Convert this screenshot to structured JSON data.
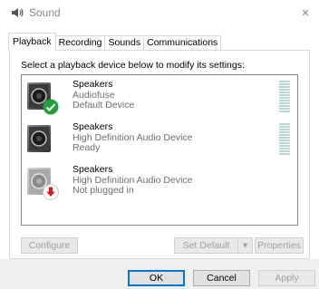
{
  "window": {
    "title": "Sound",
    "close_glyph": "×"
  },
  "tabs": [
    {
      "label": "Playback",
      "active": true
    },
    {
      "label": "Recording",
      "active": false
    },
    {
      "label": "Sounds",
      "active": false
    },
    {
      "label": "Communications",
      "active": false
    }
  ],
  "panel": {
    "instruction": "Select a playback device below to modify its settings:"
  },
  "devices": [
    {
      "name": "Speakers",
      "line1": "Audiofuse",
      "line2": "Default Device",
      "icon": "speaker-icon",
      "badge": "default-check-icon",
      "level_meter": true
    },
    {
      "name": "Speakers",
      "line1": "High Definition Audio Device",
      "line2": "Ready",
      "icon": "speaker-icon",
      "badge": "",
      "level_meter": true
    },
    {
      "name": "Speakers",
      "line1": "High Definition Audio Device",
      "line2": "Not plugged in",
      "icon": "speaker-disabled-icon",
      "badge": "unplugged-arrow-icon",
      "level_meter": false
    }
  ],
  "buttons": {
    "configure": "Configure",
    "set_default": "Set Default",
    "set_default_arrow": "▾",
    "properties": "Properties"
  },
  "footer": {
    "ok": "OK",
    "cancel": "Cancel",
    "apply": "Apply"
  },
  "colors": {
    "accent": "#0078d7",
    "check_badge": "#22a13a",
    "unplug_badge": "#d71921",
    "level_meter": "#b8d7d5"
  }
}
